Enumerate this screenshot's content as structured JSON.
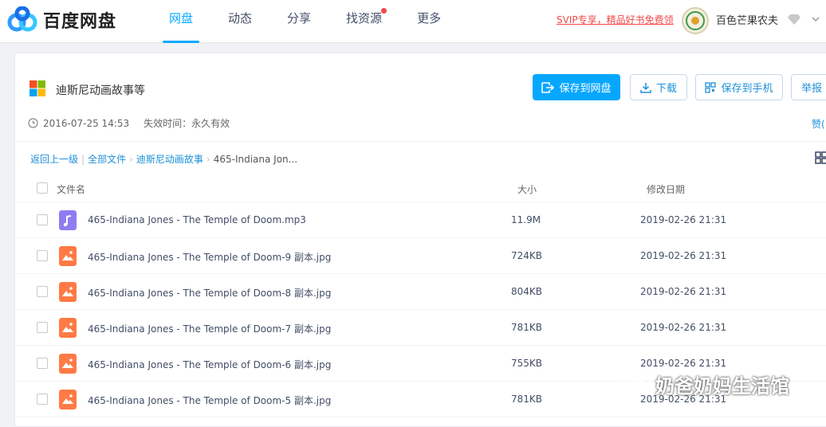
{
  "brand": {
    "name": "百度网盘"
  },
  "nav": [
    {
      "label": "网盘",
      "active": true
    },
    {
      "label": "动态",
      "active": false
    },
    {
      "label": "分享",
      "active": false
    },
    {
      "label": "找资源",
      "active": false,
      "dot": true
    },
    {
      "label": "更多",
      "active": false
    }
  ],
  "header": {
    "svip_promo": "SVIP专享，精品好书免费领",
    "username": "百色芒果农夫"
  },
  "share": {
    "title": "迪斯尼动画故事等",
    "created": "2016-07-25 14:53",
    "expiry": "失效时间：永久有效",
    "like_label": "赞("
  },
  "actions": {
    "save": "保存到网盘",
    "download": "下载",
    "save_phone": "保存到手机",
    "report": "举报"
  },
  "breadcrumb": {
    "back": "返回上一级",
    "separator_bar": "|",
    "all": "全部文件",
    "folder": "迪斯尼动画故事",
    "current": "465-Indiana Jon..."
  },
  "table": {
    "headers": {
      "name": "文件名",
      "size": "大小",
      "date": "修改日期"
    },
    "rows": [
      {
        "name": "465-Indiana Jones - The Temple of Doom.mp3",
        "size": "11.9M",
        "date": "2019-02-26 21:31",
        "type": "audio"
      },
      {
        "name": "465-Indiana Jones - The Temple of Doom-9 副本.jpg",
        "size": "724KB",
        "date": "2019-02-26 21:31",
        "type": "image"
      },
      {
        "name": "465-Indiana Jones - The Temple of Doom-8 副本.jpg",
        "size": "804KB",
        "date": "2019-02-26 21:31",
        "type": "image"
      },
      {
        "name": "465-Indiana Jones - The Temple of Doom-7 副本.jpg",
        "size": "781KB",
        "date": "2019-02-26 21:31",
        "type": "image"
      },
      {
        "name": "465-Indiana Jones - The Temple of Doom-6 副本.jpg",
        "size": "755KB",
        "date": "2019-02-26 21:31",
        "type": "image"
      },
      {
        "name": "465-Indiana Jones - The Temple of Doom-5 副本.jpg",
        "size": "781KB",
        "date": "2019-02-26 21:31",
        "type": "image"
      }
    ]
  },
  "watermark": {
    "text": "奶爸奶妈生活馆"
  },
  "colors": {
    "accent": "#06a7ff",
    "audio_icon": "#8e7cf0",
    "image_icon": "#ff7a45",
    "promo": "#f04a4a"
  },
  "icons": [
    "baidu-netdisk-logo",
    "windows-folder-icon",
    "clock-icon",
    "save-icon",
    "download-icon",
    "phone-qr-icon",
    "grid-view-icon",
    "music-file-icon",
    "image-file-icon",
    "wechat-icon"
  ]
}
